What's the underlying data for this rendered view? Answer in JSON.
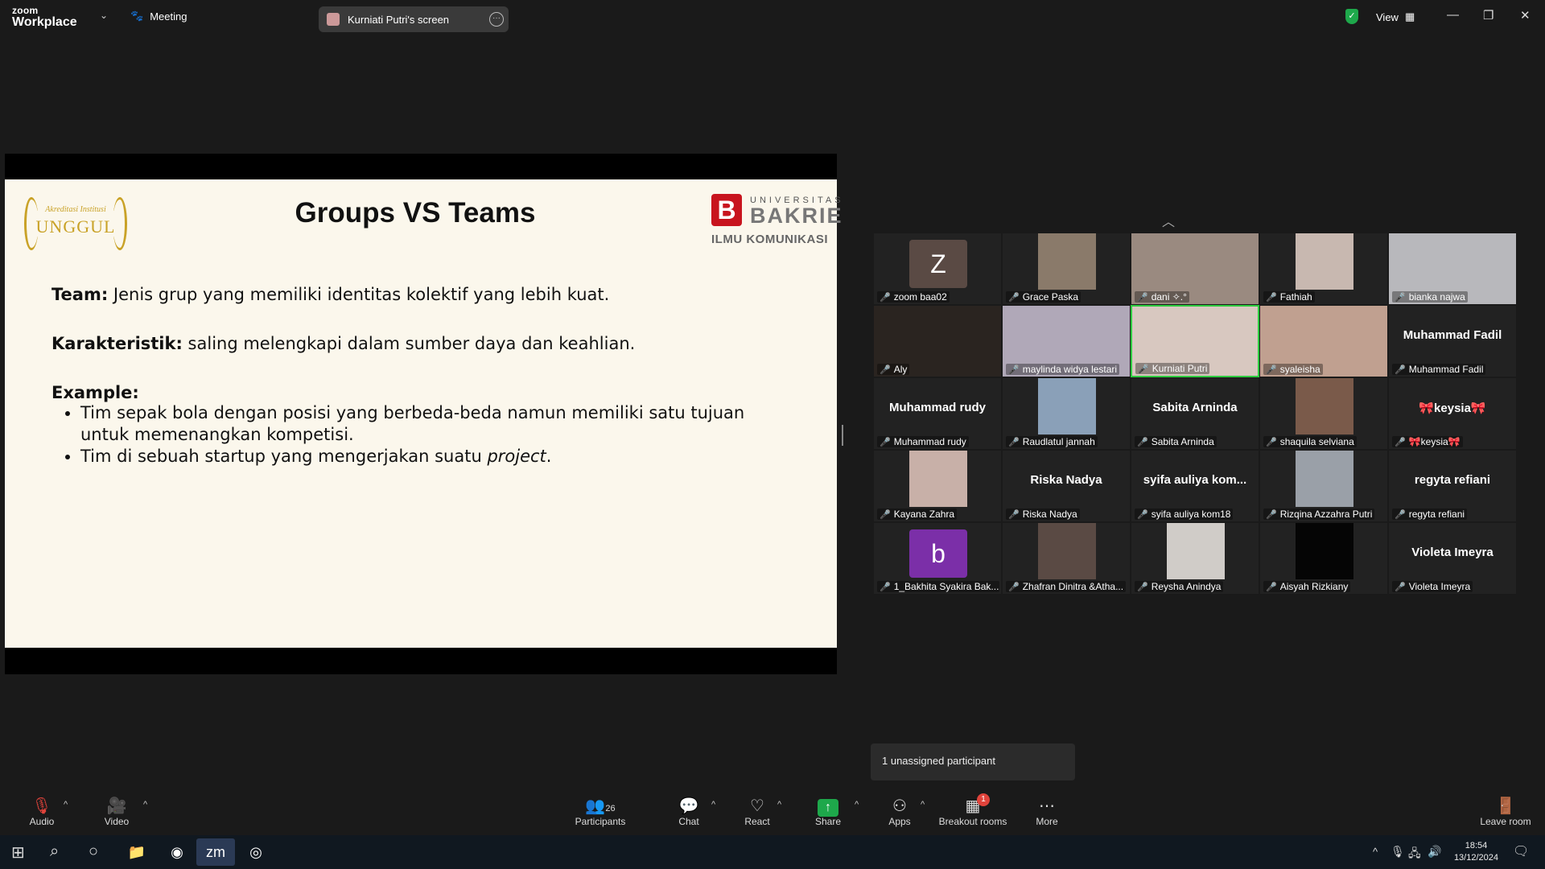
{
  "topbar": {
    "logo_top": "zoom",
    "logo_bottom": "Workplace",
    "meeting_label": "Meeting",
    "screen_pill": "Kurniati Putri's screen",
    "view_label": "View"
  },
  "slide": {
    "badge_line1": "Akreditasi Institusi",
    "badge_line2": "UNGGUL",
    "title": "Groups  VS Teams",
    "logo_letter": "B",
    "logo_uni": "UNIVERSITAS",
    "logo_name": "BAKRIE",
    "logo_dept": "ILMU KOMUNIKASI",
    "team_label": "Team:",
    "team_text": " Jenis grup yang memiliki identitas kolektif yang lebih kuat.",
    "char_label": "Karakteristik:",
    "char_text": " saling melengkapi dalam sumber daya dan keahlian.",
    "example_label": "Example:",
    "bullet1": "Tim sepak bola dengan posisi yang berbeda-beda namun memiliki satu tujuan untuk memenangkan kompetisi.",
    "bullet2_pre": "Tim di sebuah startup yang mengerjakan suatu ",
    "bullet2_em": "project",
    "bullet2_post": "."
  },
  "gallery": [
    {
      "name": "zoom baa02",
      "avatar": "Z",
      "avatar_color": "#5a4a44",
      "kind": "letter"
    },
    {
      "name": "Grace Paska",
      "kind": "photo",
      "photo_color": "#8a7a6a"
    },
    {
      "name": "dani ✧.°",
      "kind": "photo",
      "photo_color": "#9a8a80"
    },
    {
      "name": "Fathiah",
      "kind": "photo",
      "photo_color": "#c8b8b0"
    },
    {
      "name": "bianka najwa",
      "kind": "photo",
      "photo_color": "#b8b8bc"
    },
    {
      "name": "Aly",
      "kind": "photo",
      "photo_color": "#2a2420"
    },
    {
      "name": "maylinda widya lestari",
      "kind": "photo",
      "photo_color": "#b0a8b8"
    },
    {
      "name": "Kurniati Putri",
      "kind": "photo",
      "photo_color": "#d8c8c0",
      "active": true
    },
    {
      "name": "syaleisha",
      "kind": "photo",
      "photo_color": "#c0a090"
    },
    {
      "name": "Muhammad Fadil",
      "big": "Muhammad Fadil",
      "kind": "text"
    },
    {
      "name": "Muhammad rudy",
      "big": "Muhammad rudy",
      "kind": "text"
    },
    {
      "name": "Raudlatul jannah",
      "kind": "photo",
      "photo_color": "#8aa0b8"
    },
    {
      "name": "Sabita Arninda",
      "big": "Sabita Arninda",
      "kind": "text"
    },
    {
      "name": "shaquila selviana",
      "kind": "photo",
      "photo_color": "#7a5a4a"
    },
    {
      "name": "🎀keysia🎀",
      "big": "🎀keysia🎀",
      "kind": "text"
    },
    {
      "name": "Kayana Zahra",
      "kind": "photo",
      "photo_color": "#c8b0a8"
    },
    {
      "name": "Riska Nadya",
      "big": "Riska Nadya",
      "kind": "text"
    },
    {
      "name": "syifa auliya kom18",
      "big": "syifa auliya kom...",
      "kind": "text"
    },
    {
      "name": "Rizqina Azzahra Putri",
      "kind": "photo",
      "photo_color": "#9aa0a8"
    },
    {
      "name": "regyta refiani",
      "big": "regyta refiani",
      "kind": "text"
    },
    {
      "name": "1_Bakhita Syakira Bak...",
      "avatar": "b",
      "avatar_color": "#7b2fa8",
      "kind": "letter"
    },
    {
      "name": "Zhafran Dinitra &Atha...",
      "kind": "photo",
      "photo_color": "#5a4a44"
    },
    {
      "name": "Reysha Anindya",
      "kind": "photo",
      "photo_color": "#d0ccc8"
    },
    {
      "name": "Aisyah Rizkiany",
      "kind": "photo",
      "photo_color": "#050505"
    },
    {
      "name": "Violeta Imeyra",
      "big": "Violeta Imeyra",
      "kind": "text"
    }
  ],
  "unassigned": "1 unassigned participant",
  "toolbar": {
    "audio": "Audio",
    "video": "Video",
    "participants": "Participants",
    "participants_count": "26",
    "chat": "Chat",
    "react": "React",
    "share": "Share",
    "apps": "Apps",
    "breakout": "Breakout rooms",
    "breakout_badge": "1",
    "more": "More",
    "leave": "Leave room"
  },
  "taskbar": {
    "time": "18:54",
    "date": "13/12/2024"
  }
}
